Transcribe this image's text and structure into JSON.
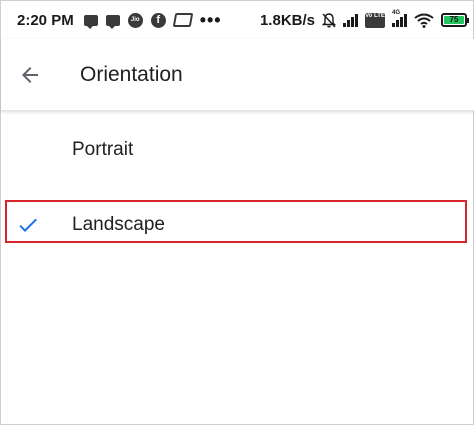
{
  "status_bar": {
    "time": "2:20 PM",
    "network_speed": "1.8KB/s",
    "jio_label": "Jio",
    "fb_label": "f",
    "volte_label": "Vo LTE",
    "lte_label": "4G",
    "battery_level": "75",
    "battery_color": "#22c55e"
  },
  "app_bar": {
    "title": "Orientation",
    "back_icon": "arrow-back-icon"
  },
  "options": [
    {
      "label": "Portrait",
      "selected": false
    },
    {
      "label": "Landscape",
      "selected": true,
      "check_icon": "check-icon",
      "check_color": "#1a73e8"
    }
  ],
  "highlight_color": "#d9232e"
}
